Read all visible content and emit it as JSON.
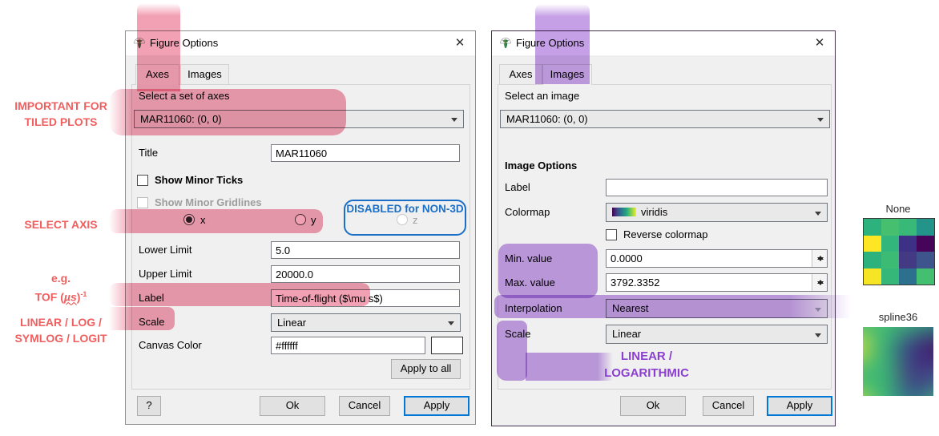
{
  "colors": {
    "pink_highlight": "#f2a0b3",
    "purple_highlight": "#c5a0e6",
    "red_text": "#f15e5e",
    "blue_text": "#1b6fc6",
    "purple_text": "#8b3fd0",
    "accent_blue": "#0078d7"
  },
  "annotations": {
    "important_1": "IMPORTANT FOR",
    "important_2": "TILED PLOTS",
    "select_axis": "SELECT AXIS",
    "eg": "e.g.",
    "tof_pre": "TOF (",
    "tof_mu": "µs",
    "tof_post": ")",
    "tof_sup": "-1",
    "linlog_1": "LINEAR / LOG /",
    "linlog_2": "SYMLOG / LOGIT",
    "disabled_3d": "DISABLED for NON-3D",
    "imglin_1": "LINEAR /",
    "imglin_2": "LOGARITHMIC"
  },
  "dialog_axes": {
    "title": "Figure Options",
    "close_glyph": "✕",
    "tab_axes": "Axes",
    "tab_images": "Images",
    "select_label": "Select a set of axes",
    "select_value": "MAR11060: (0, 0)",
    "fields": {
      "title_label": "Title",
      "title_value": "MAR11060",
      "show_minor_ticks": "Show Minor Ticks",
      "show_minor_gridlines": "Show Minor Gridlines",
      "radio_x": "x",
      "radio_y": "y",
      "radio_z": "z",
      "lower_limit_label": "Lower Limit",
      "lower_limit_value": "5.0",
      "upper_limit_label": "Upper Limit",
      "upper_limit_value": "20000.0",
      "label_label": "Label",
      "label_value": "Time-of-flight ($\\mu s$)",
      "scale_label": "Scale",
      "scale_value": "Linear",
      "canvas_color_label": "Canvas Color",
      "canvas_color_value": "#ffffff"
    },
    "buttons": {
      "apply_all": "Apply to all",
      "help": "?",
      "ok": "Ok",
      "cancel": "Cancel",
      "apply": "Apply"
    }
  },
  "dialog_images": {
    "title": "Figure Options",
    "close_glyph": "✕",
    "tab_axes": "Axes",
    "tab_images": "Images",
    "select_label": "Select an image",
    "select_value": "MAR11060: (0, 0)",
    "section_header": "Image Options",
    "fields": {
      "label_label": "Label",
      "label_value": "",
      "colormap_label": "Colormap",
      "colormap_value": "viridis",
      "reverse_colormap": "Reverse colormap",
      "min_label": "Min. value",
      "min_value": "0.0000",
      "max_label": "Max. value",
      "max_value": "3792.3352",
      "interp_label": "Interpolation",
      "interp_value": "Nearest",
      "scale_label": "Scale",
      "scale_value": "Linear"
    },
    "buttons": {
      "ok": "Ok",
      "cancel": "Cancel",
      "apply": "Apply"
    }
  },
  "preview": {
    "title_none": "None",
    "title_spline": "spline36",
    "grid_colors": [
      [
        "#2db27d",
        "#46c06e",
        "#38b977",
        "#23948a"
      ],
      [
        "#fde725",
        "#32b67c",
        "#3d3185",
        "#46045a"
      ],
      [
        "#2db27d",
        "#3cbb74",
        "#443a83",
        "#3d548c"
      ],
      [
        "#f6e525",
        "#35b779",
        "#2d708e",
        "#44bf70"
      ]
    ],
    "viridis_gradient": [
      "#440154",
      "#414487",
      "#2a788e",
      "#22a884",
      "#7ad151",
      "#fde725"
    ]
  }
}
